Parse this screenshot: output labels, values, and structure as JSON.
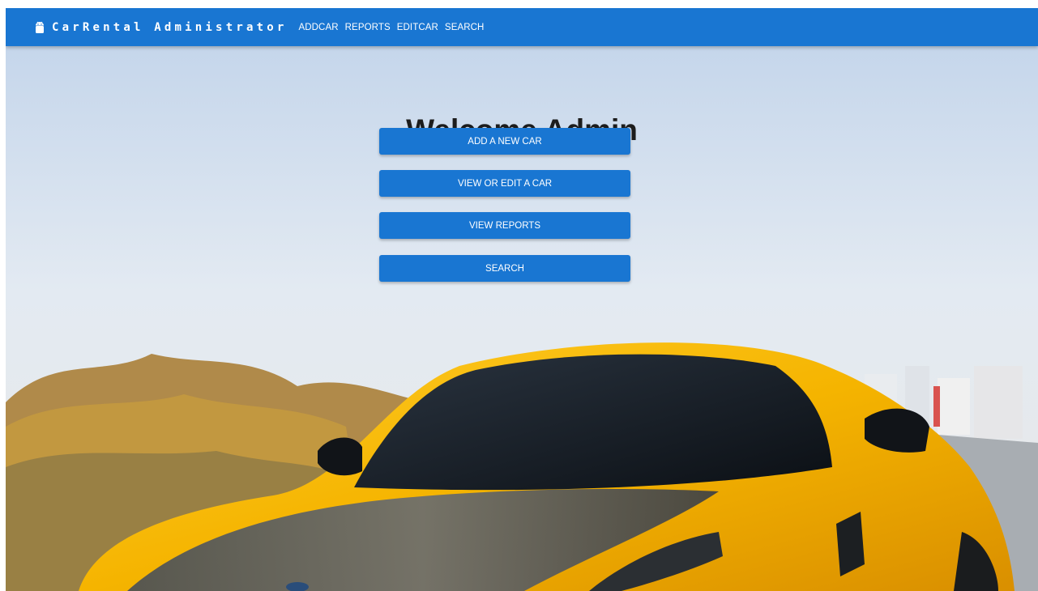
{
  "appbar": {
    "brand": "CarRental Administrator",
    "brand_icon": "android-icon",
    "nav": [
      "ADDCAR",
      "REPORTS",
      "EDITCAR",
      "SEARCH"
    ]
  },
  "main": {
    "title": "Welcome Admin",
    "buttons": [
      "ADD A NEW CAR",
      "VIEW OR EDIT A CAR",
      "VIEW REPORTS",
      "SEARCH"
    ]
  },
  "colors": {
    "primary": "#1976d2",
    "car_yellow": "#f5b800"
  }
}
